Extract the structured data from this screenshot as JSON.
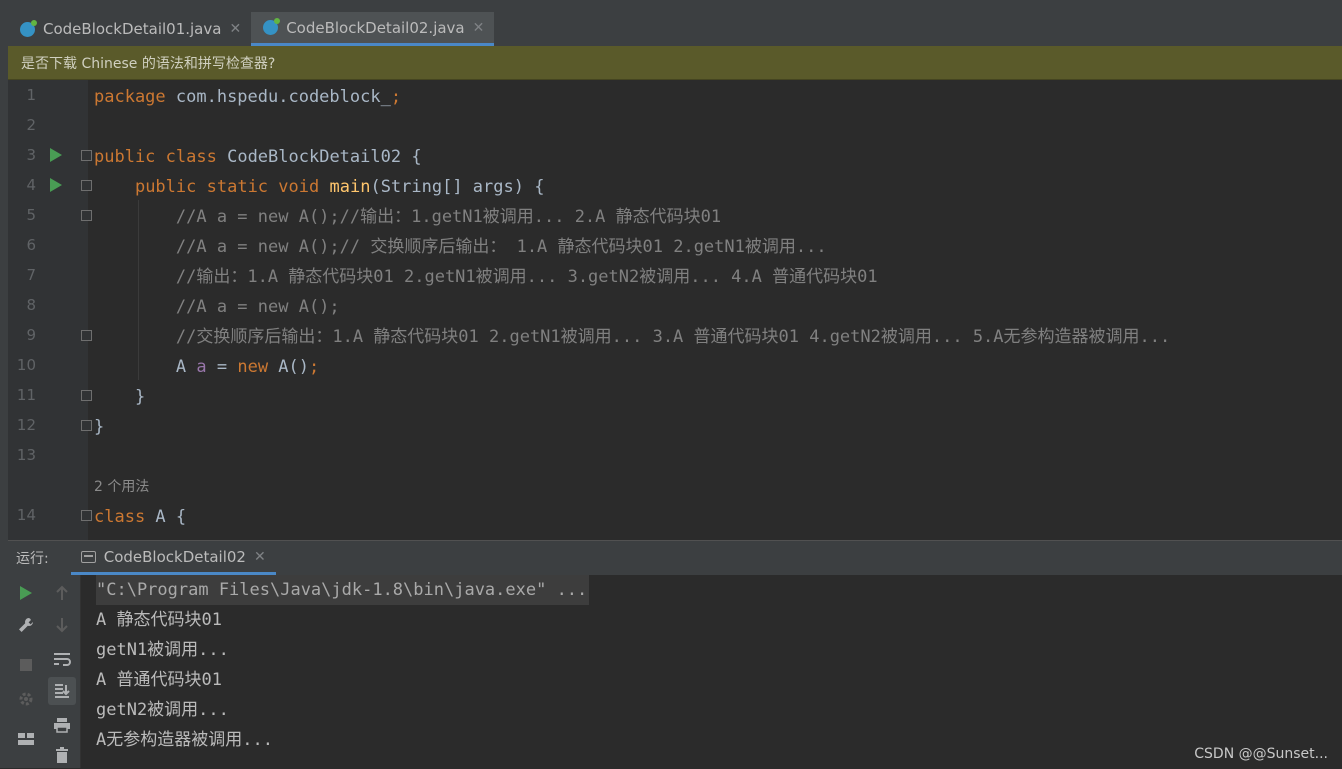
{
  "tabs": [
    {
      "label": "CodeBlockDetail01.java",
      "active": false
    },
    {
      "label": "CodeBlockDetail02.java",
      "active": true
    }
  ],
  "banner": {
    "text": "是否下载 Chinese 的语法和拼写检查器?"
  },
  "editor": {
    "line_numbers": [
      "1",
      "2",
      "3",
      "4",
      "5",
      "6",
      "7",
      "8",
      "9",
      "10",
      "11",
      "12",
      "13",
      "14"
    ],
    "usage_hint": "2 个用法",
    "lines": {
      "l1": {
        "kw": "package",
        "rest": " com.hspedu.codeblock_",
        "semi": ";"
      },
      "l3": {
        "kw1": "public",
        "kw2": "class",
        "name": " CodeBlockDetail02 {"
      },
      "l4": {
        "kw1": "public",
        "kw2": "static",
        "kw3": "void",
        "fn": "main",
        "rest": "(String[] args) {"
      },
      "l5": "//A a = new A();//输出：1.getN1被调用... 2.A 静态代码块01",
      "l6": "//A a = new A();// 交换顺序后输出： 1.A 静态代码块01 2.getN1被调用...",
      "l7": "//输出：1.A 静态代码块01 2.getN1被调用... 3.getN2被调用... 4.A 普通代码块01",
      "l8": "//A a = new A();",
      "l9": "//交换顺序后输出：1.A 静态代码块01 2.getN1被调用... 3.A 普通代码块01 4.getN2被调用... 5.A无参构造器被调用...",
      "l10": {
        "type": "A ",
        "var": "a",
        "eq": " = ",
        "kw": "new",
        "rest": " A()",
        "semi": ";"
      },
      "l11": "}",
      "l12": "}",
      "l14": {
        "kw": "class",
        "rest": " A {"
      }
    }
  },
  "run_panel": {
    "label": "运行:",
    "tab_label": "CodeBlockDetail02",
    "console_lines": [
      "\"C:\\Program Files\\Java\\jdk-1.8\\bin\\java.exe\" ...",
      "A 静态代码块01",
      "getN1被调用...",
      "A 普通代码块01",
      "getN2被调用...",
      "A无参构造器被调用..."
    ]
  },
  "watermark": "CSDN @@Sunset...",
  "icons": {
    "run": "play-icon",
    "wrench": "wrench-icon",
    "stop": "stop-icon",
    "settings": "gear-icon",
    "layout": "layout-icon",
    "up": "arrow-up-icon",
    "down": "arrow-down-icon",
    "softwrap": "soft-wrap-icon",
    "scroll_end": "scroll-to-end-icon",
    "print": "print-icon",
    "trash": "trash-icon"
  },
  "colors": {
    "keyword": "#cc7832",
    "function": "#ffc66d",
    "comment": "#808080",
    "plain": "#a9b7c6",
    "variable": "#9876aa",
    "run_green": "#499c54",
    "accent_blue": "#4a88c7"
  }
}
